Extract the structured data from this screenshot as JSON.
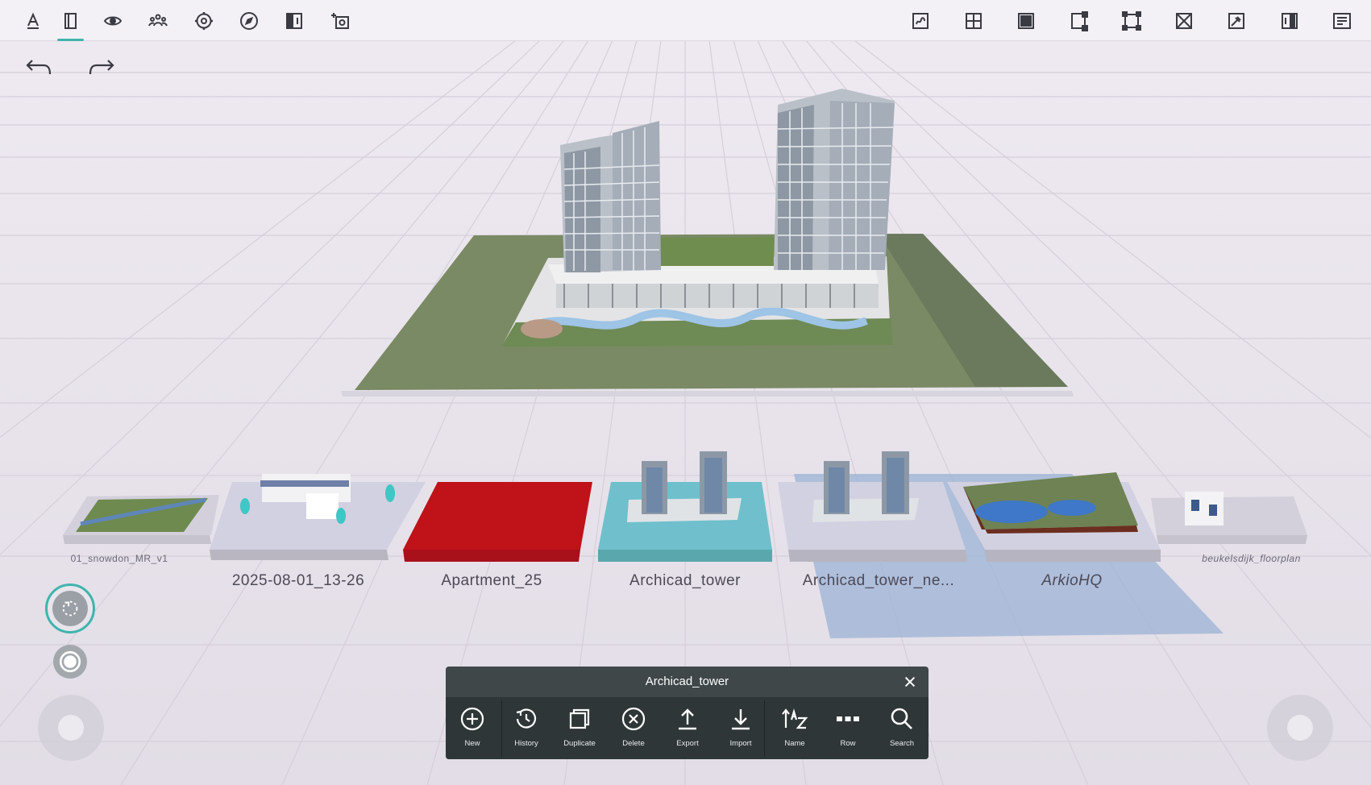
{
  "toolbar_left": [
    {
      "name": "draw-tool-icon"
    },
    {
      "name": "wall-tool-icon"
    },
    {
      "name": "view-eye-icon"
    },
    {
      "name": "collaborate-icon"
    },
    {
      "name": "settings-gear-icon"
    },
    {
      "name": "compass-icon"
    },
    {
      "name": "split-view-icon"
    },
    {
      "name": "camera-screenshot-icon"
    }
  ],
  "toolbar_right": [
    {
      "name": "sketch-plane-icon"
    },
    {
      "name": "grid-plane-icon"
    },
    {
      "name": "solid-box-icon"
    },
    {
      "name": "corner-select-icon"
    },
    {
      "name": "bounding-box-icon"
    },
    {
      "name": "cross-box-icon"
    },
    {
      "name": "pin-box-icon"
    },
    {
      "name": "section-panel-icon"
    },
    {
      "name": "text-list-icon"
    }
  ],
  "models": [
    {
      "label": "01_snowdon_MR_v1"
    },
    {
      "label": "2025-08-01_13-26"
    },
    {
      "label": "Apartment_25"
    },
    {
      "label": "Archicad_tower"
    },
    {
      "label": "Archicad_tower_ne..."
    },
    {
      "label": "ArkioHQ"
    },
    {
      "label": "beukelsdijk_floorplan"
    }
  ],
  "panel": {
    "title": "Archicad_tower",
    "buttons": [
      {
        "label": "New",
        "icon": "plus-circle-icon"
      },
      {
        "label": "History",
        "icon": "history-icon"
      },
      {
        "label": "Duplicate",
        "icon": "duplicate-icon"
      },
      {
        "label": "Delete",
        "icon": "delete-circle-icon"
      },
      {
        "label": "Export",
        "icon": "export-upload-icon"
      },
      {
        "label": "Import",
        "icon": "import-download-icon"
      },
      {
        "label": "Name",
        "icon": "sort-name-icon"
      },
      {
        "label": "Row",
        "icon": "row-dots-icon"
      },
      {
        "label": "Search",
        "icon": "search-icon"
      }
    ]
  },
  "colors": {
    "accent": "#3fb4ad",
    "panel_bg": "#3f4749",
    "apartment_red": "#bf1219",
    "archicad_teal": "#6fc0cc",
    "ground_green": "#7a8a64"
  }
}
